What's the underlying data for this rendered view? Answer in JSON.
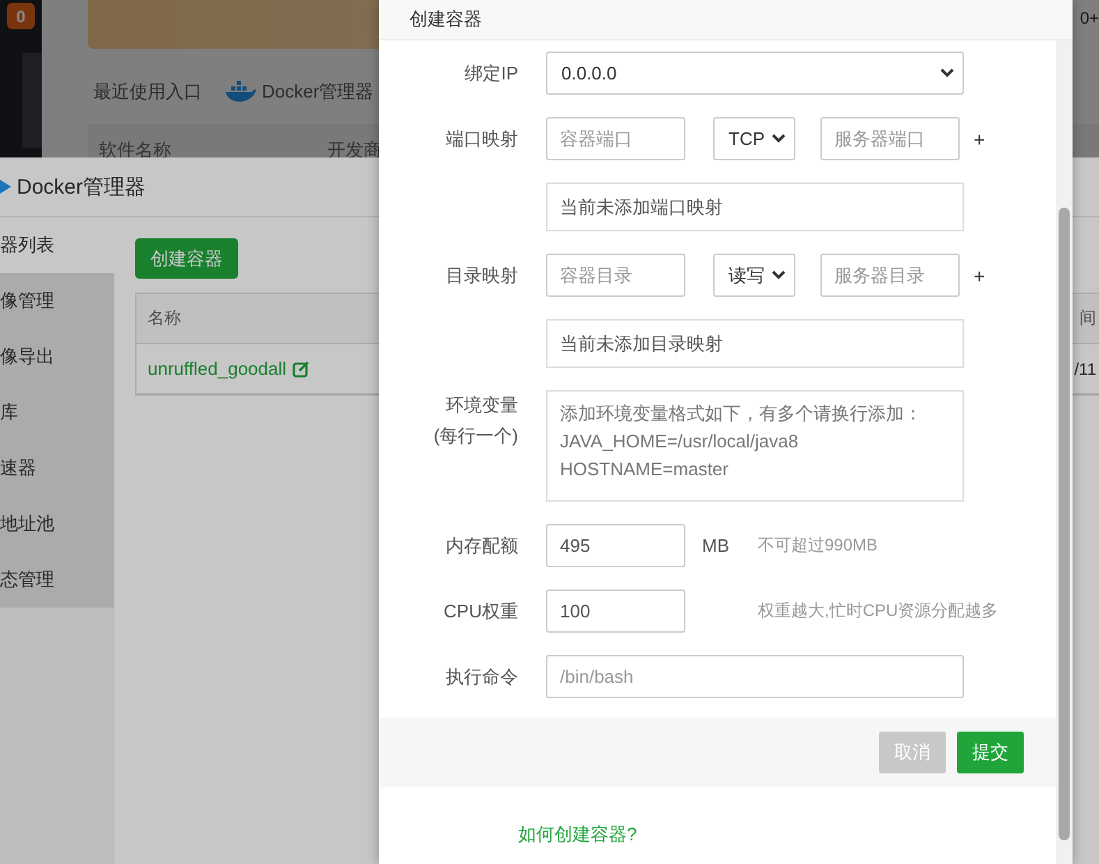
{
  "nav_badge": "0",
  "top_right_text": "0+",
  "recent": {
    "label": "最近使用入口",
    "app": "Docker管理器"
  },
  "software_table": {
    "columns": [
      "软件名称",
      "开发商"
    ]
  },
  "docker_window": {
    "title": "Docker管理器",
    "menu": [
      {
        "label": "器列表",
        "selected": true
      },
      {
        "label": "像管理",
        "selected": false
      },
      {
        "label": "像导出",
        "selected": false
      },
      {
        "label": "库",
        "selected": false
      },
      {
        "label": "速器",
        "selected": false
      },
      {
        "label": "地址池",
        "selected": false
      },
      {
        "label": "态管理",
        "selected": false
      }
    ],
    "create_button": "创建容器",
    "table": {
      "columns": [
        "名称",
        "间"
      ],
      "rows": [
        {
          "name": "unruffled_goodall",
          "column_2": "/11"
        }
      ]
    }
  },
  "dialog": {
    "title": "创建容器",
    "fields": [
      {
        "kind": "select",
        "label": "绑定IP",
        "value": "0.0.0.0"
      },
      {
        "kind": "mapping",
        "label": "端口映射",
        "left_placeholder": "容器端口",
        "option": "TCP",
        "right_placeholder": "服务器端口",
        "add": "+"
      },
      {
        "kind": "list",
        "text": "当前未添加端口映射"
      },
      {
        "kind": "mapping",
        "label": "目录映射",
        "left_placeholder": "容器目录",
        "option": "读写",
        "right_placeholder": "服务器目录",
        "add": "+"
      },
      {
        "kind": "list",
        "text": "当前未添加目录映射"
      },
      {
        "kind": "textarea",
        "label": "环境变量",
        "sublabel": "(每行一个)",
        "placeholder": "添加环境变量格式如下，有多个请换行添加：\nJAVA_HOME=/usr/local/java8\nHOSTNAME=master"
      },
      {
        "kind": "number",
        "label": "内存配额",
        "value": "495",
        "unit": "MB",
        "hint": "不可超过990MB"
      },
      {
        "kind": "number",
        "label": "CPU权重",
        "value": "100",
        "hint": "权重越大,忙时CPU资源分配越多"
      },
      {
        "kind": "text",
        "label": "执行命令",
        "placeholder": "/bin/bash"
      }
    ],
    "buttons": [
      {
        "kind": "cancel",
        "label": "取消",
        "disabled": true
      },
      {
        "kind": "submit",
        "label": "提交",
        "disabled": false
      }
    ],
    "help_link": "如何创建容器?"
  }
}
